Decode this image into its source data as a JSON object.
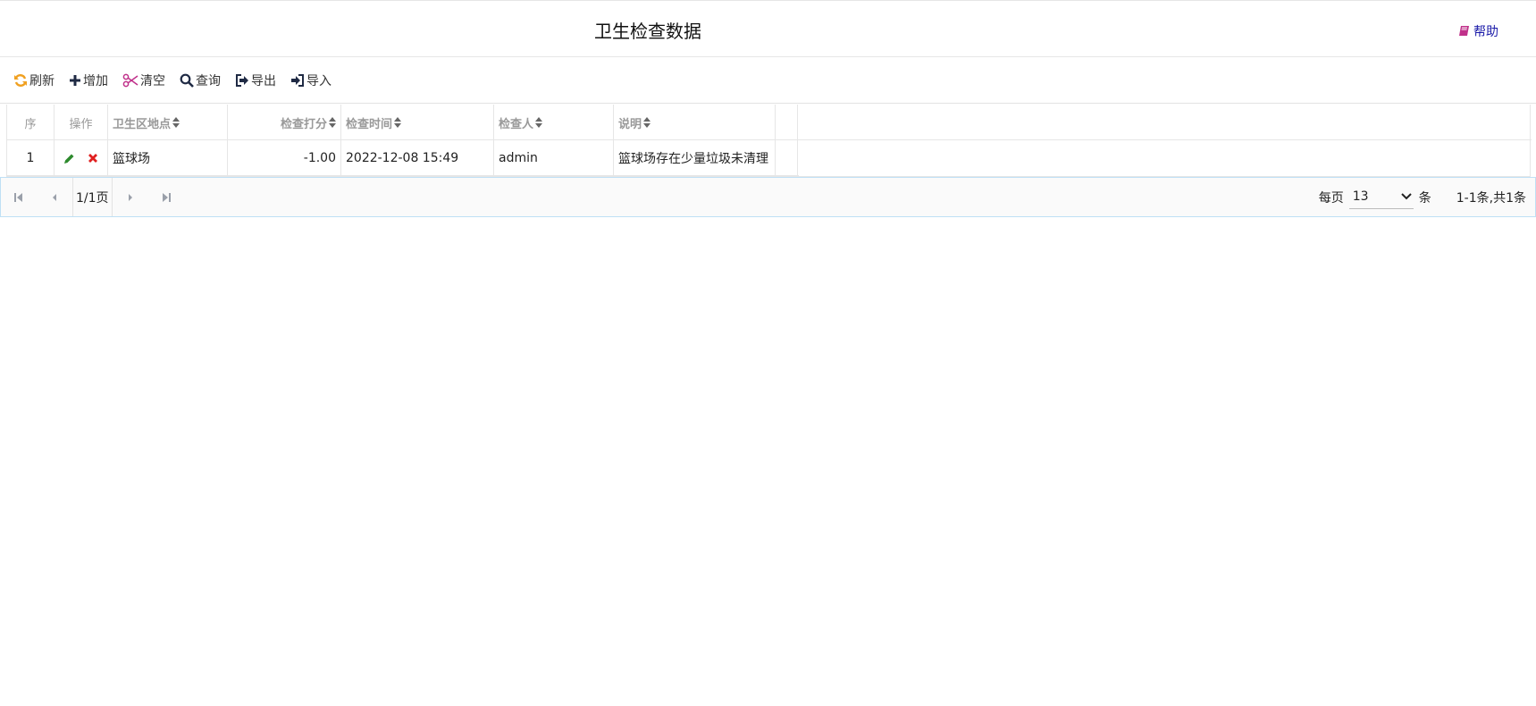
{
  "header": {
    "title": "卫生检查数据",
    "help_label": "帮助"
  },
  "toolbar": {
    "refresh": "刷新",
    "add": "增加",
    "clear": "清空",
    "query": "查询",
    "export": "导出",
    "import": "导入"
  },
  "colors": {
    "refresh": "#f0a020",
    "clear": "#c0308a",
    "help": "#c0308a",
    "edit": "#2d8a2d",
    "delete": "#e02020",
    "icon_dark": "#1f2a44"
  },
  "table": {
    "columns": {
      "seq": "序",
      "op": "操作",
      "location": "卫生区地点",
      "score": "检查打分",
      "time": "检查时间",
      "inspector": "检查人",
      "description": "说明"
    },
    "rows": [
      {
        "seq": "1",
        "location": "篮球场",
        "score": "-1.00",
        "time": "2022-12-08 15:49",
        "inspector": "admin",
        "description": "篮球场存在少量垃圾未清理"
      }
    ]
  },
  "pager": {
    "page_info": "1/1页",
    "per_page_label": "每页",
    "per_page_value": "13",
    "unit": "条",
    "total": "1-1条,共1条"
  }
}
